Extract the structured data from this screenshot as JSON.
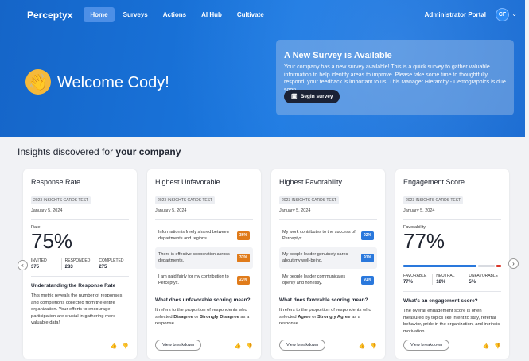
{
  "nav": {
    "logo": "Perceptyx",
    "items": [
      {
        "label": "Home",
        "active": true
      },
      {
        "label": "Surveys",
        "active": false
      },
      {
        "label": "Actions",
        "active": false
      },
      {
        "label": "AI Hub",
        "active": false
      },
      {
        "label": "Cultivate",
        "active": false
      }
    ],
    "admin_label": "Administrator Portal",
    "avatar": "CF"
  },
  "hero": {
    "welcome": "Welcome Cody!",
    "survey_title": "A New Survey is Available",
    "survey_text": "Your company has a new survey available! This is a quick survey to gather valuable information to help identify areas to improve. Please take some time to thoughtfully respond, your feedback is important to us! This Manager Hierarchy - Demographics is due soon.",
    "begin_label": "Begin survey"
  },
  "insights": {
    "prefix": "Insights discovered for ",
    "strong": "your company"
  },
  "cards": {
    "response": {
      "title": "Response Rate",
      "tag": "2023 INSIGHTS CARDS TEST",
      "date": "January 5, 2024",
      "metric_label": "Rate",
      "metric_value": "75%",
      "stats": [
        {
          "label": "INVITED",
          "value": "375"
        },
        {
          "label": "RESPONDED",
          "value": "283"
        },
        {
          "label": "COMPLETED",
          "value": "275"
        }
      ],
      "sub_title": "Understanding the Response Rate",
      "body": "This metric reveals the number of responses and completions collected from the entire organization. Your efforts to encourage participation are crucial in gathering more valuable data!"
    },
    "unfavorable": {
      "title": "Highest Unfavorable",
      "tag": "2023 INSIGHTS CARDS TEST",
      "date": "January 5, 2024",
      "items": [
        {
          "text": "Information is freely shared between departments and regions.",
          "value": "36%"
        },
        {
          "text": "There is effective cooperation across departments.",
          "value": "33%"
        },
        {
          "text": "I am paid fairly for my contribution to Perceptyx.",
          "value": "23%"
        }
      ],
      "sub_title": "What does unfavorable scoring mean?",
      "body_1": "It refers to the proportion of respondents who selected ",
      "body_b1": "Disagree",
      "body_2": " or ",
      "body_b2": "Strongly Disagree",
      "body_3": " as a response.",
      "button": "View breakdown"
    },
    "favorable": {
      "title": "Highest Favorability",
      "tag": "2023 INSIGHTS CARDS TEST",
      "date": "January 5, 2024",
      "items": [
        {
          "text": "My work contributes to the success of Perceptyx.",
          "value": "92%"
        },
        {
          "text": "My people leader genuinely cares about my well-being.",
          "value": "91%"
        },
        {
          "text": "My people leader communicates openly and honestly.",
          "value": "91%"
        }
      ],
      "sub_title": "What does favorable scoring mean?",
      "body_1": "It refers to the proportion of respondents who selected ",
      "body_b1": "Agree",
      "body_2": " or ",
      "body_b2": "Strongly Agree",
      "body_3": " as a response.",
      "button": "View breakdown"
    },
    "engagement": {
      "title": "Engagement Score",
      "tag": "2023 INSIGHTS CARDS TEST",
      "date": "January 5, 2024",
      "metric_label": "Favorability",
      "metric_value": "77%",
      "bar": {
        "favorable": 0.77,
        "neutral": 0.18,
        "unfavorable": 0.05
      },
      "colors": {
        "favorable": "#2a78dc",
        "neutral": "#d8dbe1",
        "unfavorable": "#d9382b"
      },
      "stats": [
        {
          "label": "FAVORABLE",
          "value": "77%"
        },
        {
          "label": "NEUTRAL",
          "value": "18%"
        },
        {
          "label": "UNFAVORABLE",
          "value": "5%"
        }
      ],
      "sub_title": "What's an engagement score?",
      "body": "The overall engagement score is often measured by topics like intent to stay, referral behavior, pride in the organization, and intrinsic motivation.",
      "button": "View breakdown"
    }
  },
  "icons": {
    "thumbs_up": "👍",
    "thumbs_down": "👎",
    "wave": "👋",
    "prev": "‹",
    "next": "›",
    "chevron": "⌄",
    "calendar": "🗓"
  }
}
